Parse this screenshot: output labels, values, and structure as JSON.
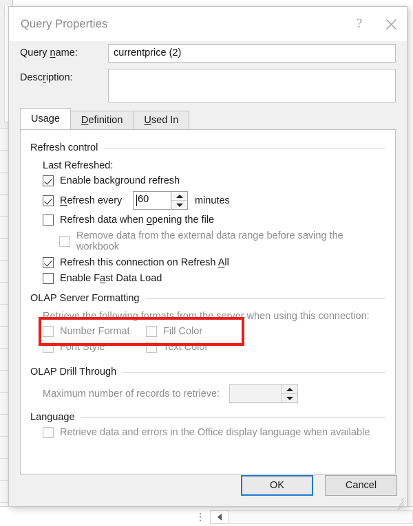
{
  "window": {
    "title": "Query Properties",
    "help_icon": "question-mark-icon",
    "close_icon": "close-icon",
    "help_glyph": "?"
  },
  "header": {
    "query_name_label": "Query name:",
    "query_name_value": "currentprice (2)",
    "description_label": "Description:",
    "description_value": "",
    "description_placeholder": ""
  },
  "tabs": [
    {
      "label": "Usage",
      "active": true
    },
    {
      "label": "Definition",
      "active": false
    },
    {
      "label": "Used In",
      "active": false
    }
  ],
  "usage": {
    "refresh_control": {
      "title": "Refresh control",
      "last_refreshed_label": "Last Refreshed:",
      "enable_background_refresh": {
        "label": "Enable background refresh",
        "checked": true,
        "enabled": true
      },
      "refresh_every": {
        "label": "Refresh every",
        "checked": true,
        "enabled": true,
        "value": "60",
        "unit": "minutes",
        "highlighted": true
      },
      "refresh_on_open": {
        "label": "Refresh data when opening the file",
        "checked": false,
        "enabled": true
      },
      "remove_data": {
        "label": "Remove data from the external data range before saving the workbook",
        "checked": false,
        "enabled": false
      },
      "refresh_all": {
        "label": "Refresh this connection on Refresh All",
        "checked": true,
        "enabled": true
      },
      "fast_data_load": {
        "label": "Enable Fast Data Load",
        "checked": false,
        "enabled": true
      }
    },
    "olap_server_formatting": {
      "title": "OLAP Server Formatting",
      "description": "Retrieve the following formats from the server when using this connection:",
      "options": [
        {
          "label": "Number Format",
          "checked": false,
          "enabled": false
        },
        {
          "label": "Fill Color",
          "checked": false,
          "enabled": false
        },
        {
          "label": "Font Style",
          "checked": false,
          "enabled": false
        },
        {
          "label": "Text Color",
          "checked": false,
          "enabled": false
        }
      ]
    },
    "olap_drill_through": {
      "title": "OLAP Drill Through",
      "max_records_label": "Maximum number of records to retrieve:",
      "max_records_value": "",
      "enabled": false
    },
    "language": {
      "title": "Language",
      "option": {
        "label": "Retrieve data and errors in the Office display language when available",
        "checked": false,
        "enabled": false
      }
    }
  },
  "footer": {
    "ok_label": "OK",
    "cancel_label": "Cancel"
  },
  "highlight": {
    "color": "#ec1c19"
  },
  "backdrop": {
    "app": "excel-worksheet",
    "scroll_left_icon": "triangle-left-icon"
  }
}
